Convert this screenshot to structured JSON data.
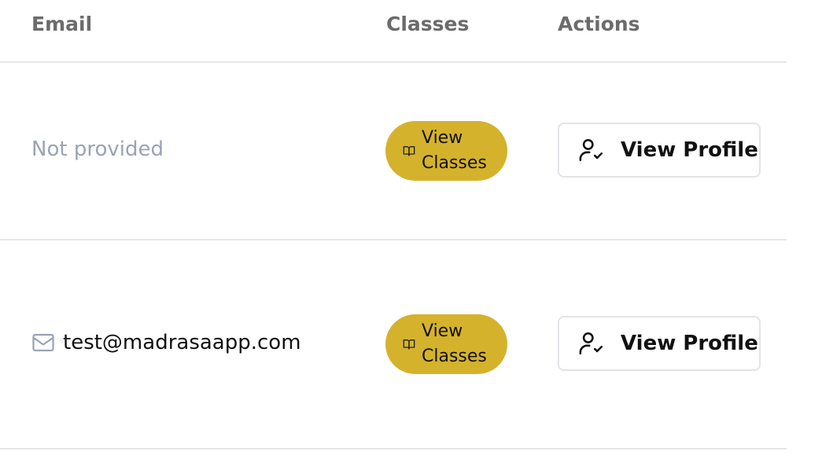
{
  "table": {
    "headers": {
      "email": "Email",
      "classes": "Classes",
      "actions": "Actions"
    },
    "rows": [
      {
        "email": "Not provided",
        "email_provided": false,
        "classes_label": "View Classes",
        "action_label": "View Profile"
      },
      {
        "email": "test@madrasaapp.com",
        "email_provided": true,
        "classes_label": "View Classes",
        "action_label": "View Profile"
      }
    ]
  },
  "colors": {
    "classes_button_bg": "#d4b22c",
    "muted_text": "#9aa3b5",
    "header_text": "#6b6b6b",
    "divider": "#e5e7eb"
  },
  "icons": {
    "mail": "mail-icon",
    "book": "book-open-icon",
    "profile": "user-check-icon"
  }
}
